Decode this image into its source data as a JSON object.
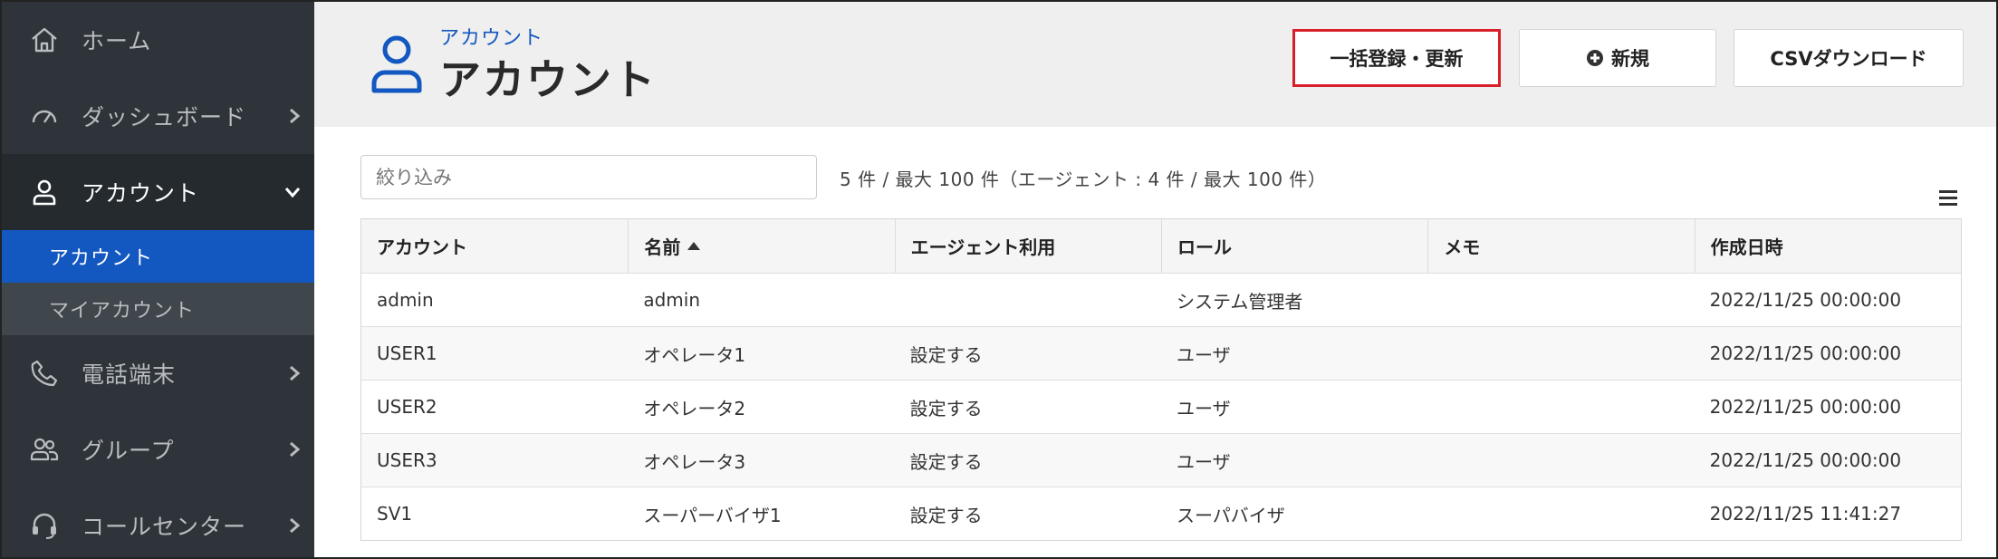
{
  "sidebar": {
    "items": [
      {
        "label": "ホーム"
      },
      {
        "label": "ダッシュボード"
      },
      {
        "label": "アカウント"
      },
      {
        "label": "電話端末"
      },
      {
        "label": "グループ"
      },
      {
        "label": "コールセンター"
      }
    ],
    "subitems": [
      {
        "label": "アカウント"
      },
      {
        "label": "マイアカウント"
      }
    ]
  },
  "header": {
    "subtitle": "アカウント",
    "title": "アカウント",
    "buttons": {
      "bulk": "一括登録・更新",
      "new": "新規",
      "csv": "CSVダウンロード"
    }
  },
  "filter": {
    "placeholder": "絞り込み"
  },
  "count_text": "5 件 / 最大 100 件（エージェント : 4 件 / 最大 100 件）",
  "table": {
    "columns": [
      "アカウント",
      "名前",
      "エージェント利用",
      "ロール",
      "メモ",
      "作成日時"
    ],
    "sorted_column": "名前",
    "rows": [
      [
        "admin",
        "admin",
        "",
        "システム管理者",
        "",
        "2022/11/25 00:00:00"
      ],
      [
        "USER1",
        "オペレータ1",
        "設定する",
        "ユーザ",
        "",
        "2022/11/25 00:00:00"
      ],
      [
        "USER2",
        "オペレータ2",
        "設定する",
        "ユーザ",
        "",
        "2022/11/25 00:00:00"
      ],
      [
        "USER3",
        "オペレータ3",
        "設定する",
        "ユーザ",
        "",
        "2022/11/25 00:00:00"
      ],
      [
        "SV1",
        "スーパーバイザ1",
        "設定する",
        "スーパバイザ",
        "",
        "2022/11/25 11:41:27"
      ]
    ]
  },
  "colors": {
    "sidebar_bg": "#2e3439",
    "accent_blue": "#1357c0",
    "highlight_red": "#d8202a"
  }
}
